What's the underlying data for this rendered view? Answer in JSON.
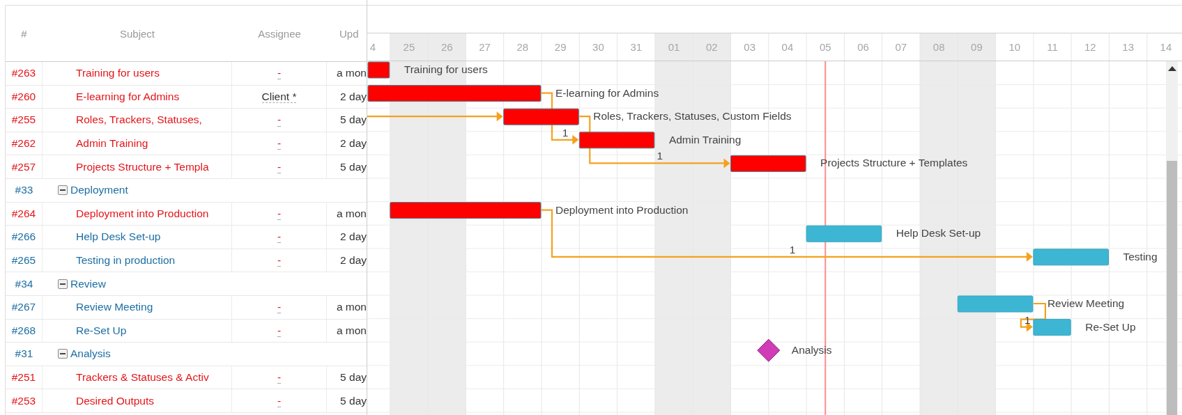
{
  "table": {
    "columns": [
      "#",
      "Subject",
      "Assignee",
      "Upd"
    ],
    "rows": [
      {
        "kind": "task",
        "id": "#263",
        "subject": "Training for users",
        "assignee": "-",
        "updated": "a mon",
        "overdue": true,
        "bar_label": "Training for users"
      },
      {
        "kind": "task",
        "id": "#260",
        "subject": "E-learning for Admins",
        "assignee": "Client *",
        "updated": "2 day",
        "overdue": true,
        "bar_label": "E-learning for Admins"
      },
      {
        "kind": "task",
        "id": "#255",
        "subject": "Roles, Trackers, Statuses,",
        "assignee": "-",
        "updated": "5 day",
        "overdue": true,
        "bar_label": "Roles, Trackers, Statuses, Custom Fields"
      },
      {
        "kind": "task",
        "id": "#262",
        "subject": "Admin Training",
        "assignee": "-",
        "updated": "2 day",
        "overdue": true,
        "bar_label": "Admin Training"
      },
      {
        "kind": "task",
        "id": "#257",
        "subject": "Projects Structure + Templa",
        "assignee": "-",
        "updated": "5 day",
        "overdue": true,
        "bar_label": "Projects Structure + Templates"
      },
      {
        "kind": "group",
        "id": "#33",
        "subject": "Deployment",
        "expanded": true
      },
      {
        "kind": "task",
        "id": "#264",
        "subject": "Deployment into Production",
        "assignee": "-",
        "updated": "a mon",
        "overdue": true,
        "bar_label": "Deployment into Production"
      },
      {
        "kind": "task",
        "id": "#266",
        "subject": "Help Desk Set-up",
        "assignee": "-",
        "updated": "2 day",
        "overdue": false,
        "bar_label": "Help Desk Set-up"
      },
      {
        "kind": "task",
        "id": "#265",
        "subject": "Testing in production",
        "assignee": "-",
        "updated": "2 day",
        "overdue": false,
        "bar_label": "Testing"
      },
      {
        "kind": "group",
        "id": "#34",
        "subject": "Review",
        "expanded": true
      },
      {
        "kind": "task",
        "id": "#267",
        "subject": "Review Meeting",
        "assignee": "-",
        "updated": "a mon",
        "overdue": false,
        "bar_label": "Review Meeting"
      },
      {
        "kind": "task",
        "id": "#268",
        "subject": "Re-Set Up",
        "assignee": "-",
        "updated": "a mon",
        "overdue": false,
        "bar_label": "Re-Set Up"
      },
      {
        "kind": "group",
        "id": "#31",
        "subject": "Analysis",
        "expanded": true,
        "milestone_label": "Analysis"
      },
      {
        "kind": "task",
        "id": "#251",
        "subject": "Trackers & Statuses & Activ",
        "assignee": "-",
        "updated": "5 day",
        "overdue": true
      },
      {
        "kind": "task",
        "id": "#253",
        "subject": "Desired Outputs",
        "assignee": "-",
        "updated": "5 day",
        "overdue": true
      }
    ]
  },
  "gantt": {
    "days": [
      {
        "label": "4",
        "weekend": false
      },
      {
        "label": "25",
        "weekend": true
      },
      {
        "label": "26",
        "weekend": true
      },
      {
        "label": "27",
        "weekend": false
      },
      {
        "label": "28",
        "weekend": false
      },
      {
        "label": "29",
        "weekend": false
      },
      {
        "label": "30",
        "weekend": false
      },
      {
        "label": "31",
        "weekend": false
      },
      {
        "label": "01",
        "weekend": true
      },
      {
        "label": "02",
        "weekend": true
      },
      {
        "label": "03",
        "weekend": false
      },
      {
        "label": "04",
        "weekend": false
      },
      {
        "label": "05",
        "weekend": false
      },
      {
        "label": "06",
        "weekend": false
      },
      {
        "label": "07",
        "weekend": false
      },
      {
        "label": "08",
        "weekend": true
      },
      {
        "label": "09",
        "weekend": true
      },
      {
        "label": "10",
        "weekend": false
      },
      {
        "label": "11",
        "weekend": false
      },
      {
        "label": "12",
        "weekend": false
      },
      {
        "label": "13",
        "weekend": false
      },
      {
        "label": "14",
        "weekend": false
      }
    ],
    "link_labels": [
      "1",
      "1",
      "1",
      "1"
    ]
  }
}
